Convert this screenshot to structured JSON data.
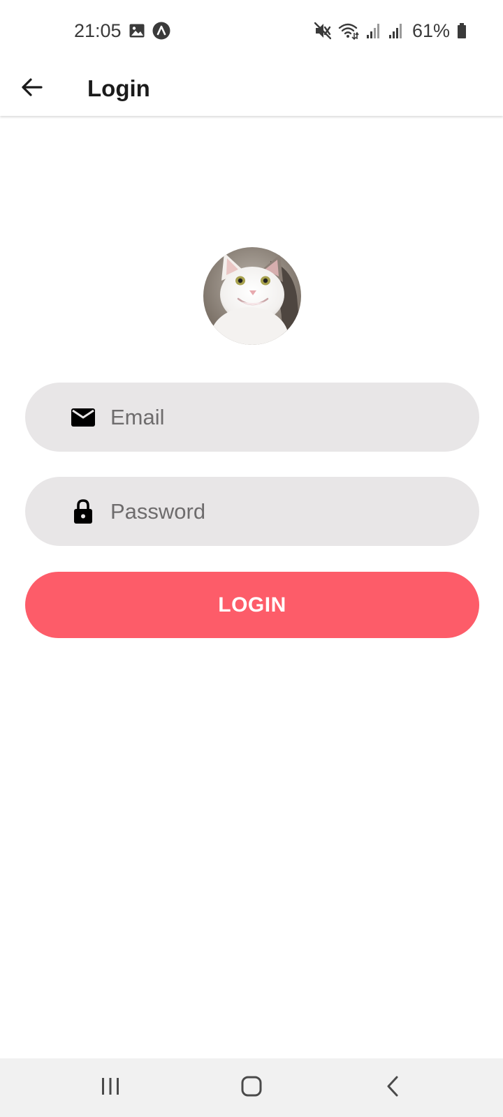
{
  "status_bar": {
    "time": "21:05",
    "battery": "61%",
    "icons": [
      "gallery-icon",
      "app-notification-icon",
      "mute-icon",
      "wifi-icon",
      "signal-icon",
      "signal-icon",
      "battery-icon"
    ]
  },
  "app_bar": {
    "title": "Login",
    "back_icon": "arrow-back-icon"
  },
  "form": {
    "email": {
      "placeholder": "Email",
      "value": "",
      "icon": "mail-icon"
    },
    "password": {
      "placeholder": "Password",
      "value": "",
      "icon": "lock-icon"
    },
    "login_label": "LOGIN"
  },
  "colors": {
    "accent": "#fd5c69",
    "field_bg": "#e8e6e7",
    "nav_bg": "#f1f1f1"
  },
  "nav_bar": {
    "icons": [
      "recents-icon",
      "home-icon",
      "back-icon"
    ]
  }
}
